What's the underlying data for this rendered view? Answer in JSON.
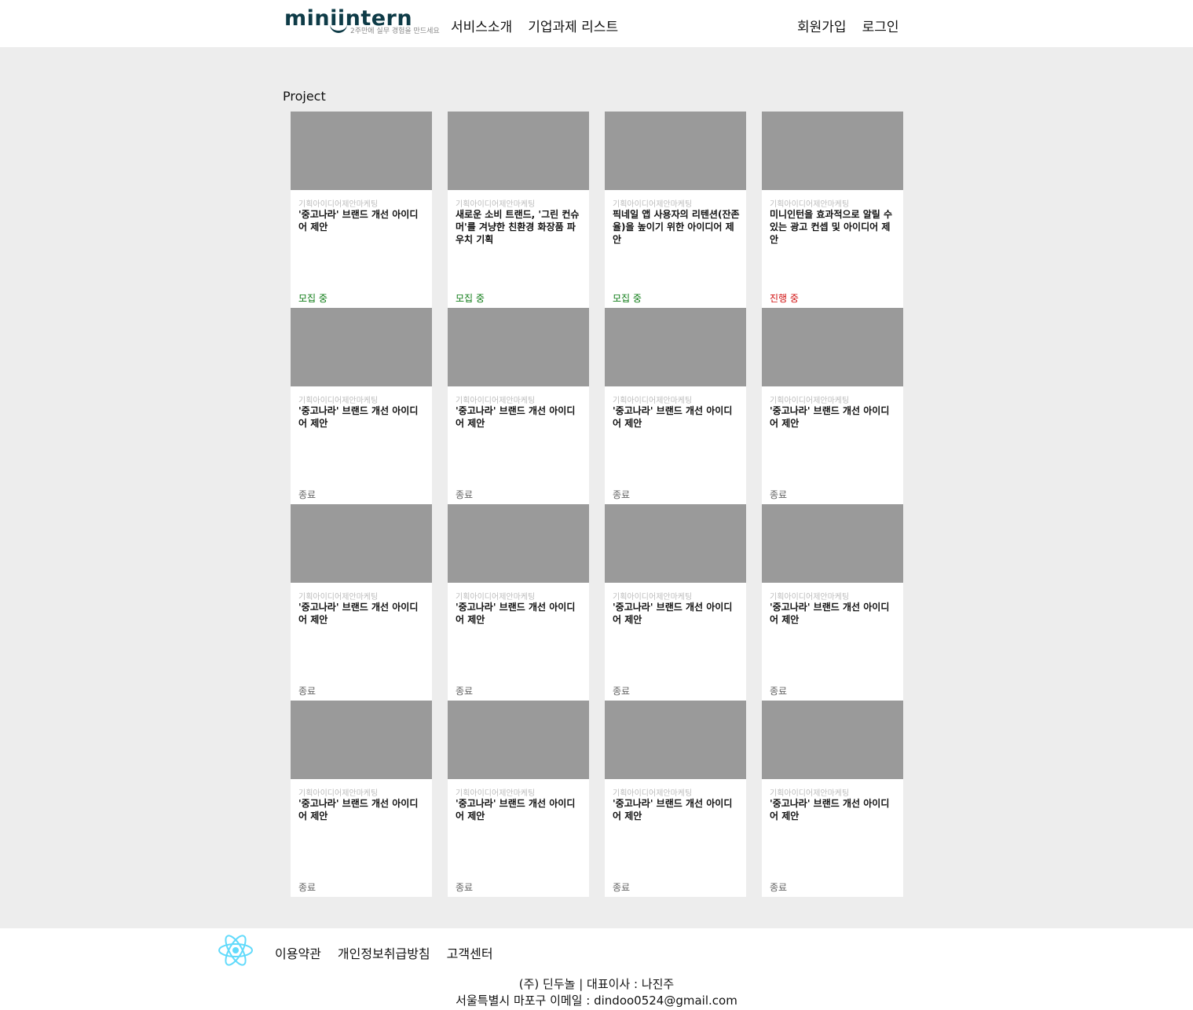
{
  "header": {
    "logo_text": "miniintern",
    "logo_tagline": "2주만에 실무 경험을 만드세요",
    "nav": [
      "서비스소개",
      "기업과제 리스트"
    ],
    "auth": [
      "회원가입",
      "로그인"
    ]
  },
  "main": {
    "section_title": "Project",
    "cards": [
      {
        "category": "기획아이디어제안마케팅",
        "title": "'중고나라' 브랜드 개선 아이디어 제안",
        "status": "모집 중",
        "status_type": "recruiting"
      },
      {
        "category": "기획아이디어제안마케팅",
        "title": "새로운 소비 트랜드, '그린 컨슈머'를 겨냥한 친환경 화장품 파우치 기획",
        "status": "모집 중",
        "status_type": "recruiting"
      },
      {
        "category": "기획아이디어제안마케팅",
        "title": "픽네일 앱 사용자의 리텐션(잔존율)을 높이기 위한 아이디어 제안",
        "status": "모집 중",
        "status_type": "recruiting"
      },
      {
        "category": "기획아이디어제안마케팅",
        "title": "미니인턴을 효과적으로 알릴 수 있는 광고 컨셉 및 아이디어 제안",
        "status": "진행 중",
        "status_type": "progress"
      },
      {
        "category": "기획아이디어제안마케팅",
        "title": "'중고나라' 브랜드 개선 아이디어 제안",
        "status": "종료",
        "status_type": "closed"
      },
      {
        "category": "기획아이디어제안마케팅",
        "title": "'중고나라' 브랜드 개선 아이디어 제안",
        "status": "종료",
        "status_type": "closed"
      },
      {
        "category": "기획아이디어제안마케팅",
        "title": "'중고나라' 브랜드 개선 아이디어 제안",
        "status": "종료",
        "status_type": "closed"
      },
      {
        "category": "기획아이디어제안마케팅",
        "title": "'중고나라' 브랜드 개선 아이디어 제안",
        "status": "종료",
        "status_type": "closed"
      },
      {
        "category": "기획아이디어제안마케팅",
        "title": "'중고나라' 브랜드 개선 아이디어 제안",
        "status": "종료",
        "status_type": "closed"
      },
      {
        "category": "기획아이디어제안마케팅",
        "title": "'중고나라' 브랜드 개선 아이디어 제안",
        "status": "종료",
        "status_type": "closed"
      },
      {
        "category": "기획아이디어제안마케팅",
        "title": "'중고나라' 브랜드 개선 아이디어 제안",
        "status": "종료",
        "status_type": "closed"
      },
      {
        "category": "기획아이디어제안마케팅",
        "title": "'중고나라' 브랜드 개선 아이디어 제안",
        "status": "종료",
        "status_type": "closed"
      },
      {
        "category": "기획아이디어제안마케팅",
        "title": "'중고나라' 브랜드 개선 아이디어 제안",
        "status": "종료",
        "status_type": "closed"
      },
      {
        "category": "기획아이디어제안마케팅",
        "title": "'중고나라' 브랜드 개선 아이디어 제안",
        "status": "종료",
        "status_type": "closed"
      },
      {
        "category": "기획아이디어제안마케팅",
        "title": "'중고나라' 브랜드 개선 아이디어 제안",
        "status": "종료",
        "status_type": "closed"
      },
      {
        "category": "기획아이디어제안마케팅",
        "title": "'중고나라' 브랜드 개선 아이디어 제안",
        "status": "종료",
        "status_type": "closed"
      }
    ]
  },
  "footer": {
    "logo_icon": "react-icon",
    "links": [
      "이용약관",
      "개인정보취급방침",
      "고객센터"
    ],
    "company_line1": "(주) 딘두놀 | 대표이사 : 나진주",
    "company_line2": "서울특별시 마포구 이메일 : dindoo0524@gmail.com"
  },
  "colors": {
    "brand": "#0e3b47",
    "recruiting": "#0a7a12",
    "progress": "#d11010",
    "closed": "#666666",
    "react": "#61dafb"
  }
}
